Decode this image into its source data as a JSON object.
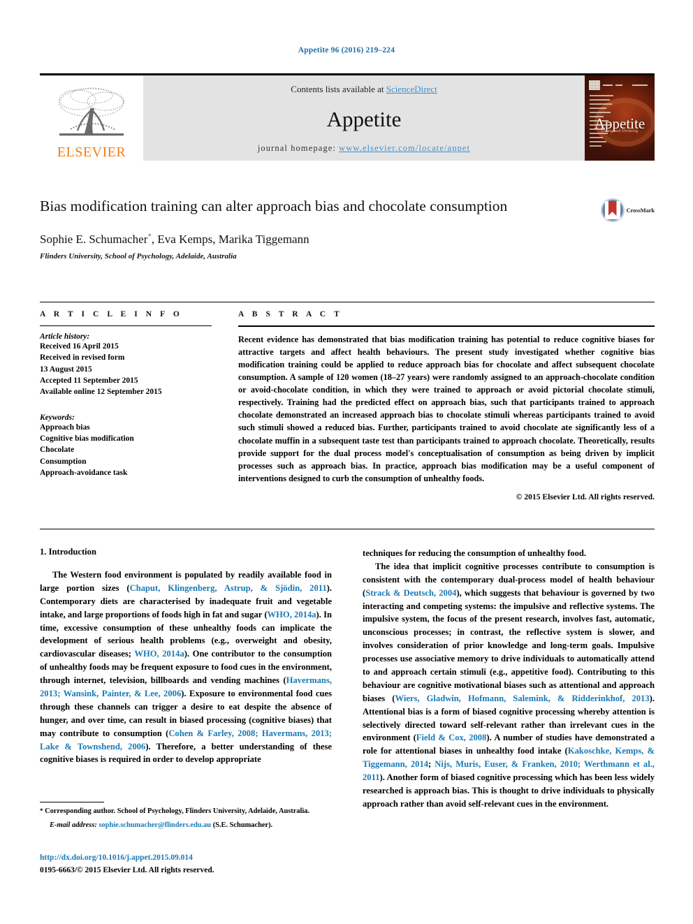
{
  "running_head": "Appetite 96 (2016) 219–224",
  "masthead": {
    "publisher_name": "ELSEVIER",
    "contents_prefix": "Contents lists available at ",
    "contents_link": "ScienceDirect",
    "journal_name": "Appetite",
    "homepage_prefix": "journal homepage: ",
    "homepage_url": "www.elsevier.com/locate/appet",
    "cover_title": "Appetite",
    "cover_subtitle": "Eating and Drinking"
  },
  "article": {
    "title": "Bias modification training can alter approach bias and chocolate consumption",
    "authors": "Sophie E. Schumacher, Eva Kemps, Marika Tiggemann",
    "corresponding_marker": "*",
    "affiliation": "Flinders University, School of Psychology, Adelaide, Australia",
    "crossmark_label": "CrossMark"
  },
  "info": {
    "heading": "A R T I C L E   I N F O",
    "history_label": "Article history:",
    "history": [
      "Received 16 April 2015",
      "Received in revised form",
      "13 August 2015",
      "Accepted 11 September 2015",
      "Available online 12 September 2015"
    ],
    "keywords_label": "Keywords:",
    "keywords": [
      "Approach bias",
      "Cognitive bias modification",
      "Chocolate",
      "Consumption",
      "Approach-avoidance task"
    ]
  },
  "abstract": {
    "heading": "A B S T R A C T",
    "text": "Recent evidence has demonstrated that bias modification training has potential to reduce cognitive biases for attractive targets and affect health behaviours. The present study investigated whether cognitive bias modification training could be applied to reduce approach bias for chocolate and affect subsequent chocolate consumption. A sample of 120 women (18–27 years) were randomly assigned to an approach-chocolate condition or avoid-chocolate condition, in which they were trained to approach or avoid pictorial chocolate stimuli, respectively. Training had the predicted effect on approach bias, such that participants trained to approach chocolate demonstrated an increased approach bias to chocolate stimuli whereas participants trained to avoid such stimuli showed a reduced bias. Further, participants trained to avoid chocolate ate significantly less of a chocolate muffin in a subsequent taste test than participants trained to approach chocolate. Theoretically, results provide support for the dual process model's conceptualisation of consumption as being driven by implicit processes such as approach bias. In practice, approach bias modification may be a useful component of interventions designed to curb the consumption of unhealthy foods.",
    "copyright": "© 2015 Elsevier Ltd. All rights reserved."
  },
  "body": {
    "section_heading": "1.  Introduction",
    "left_paragraph_1": {
      "p1": "The Western food environment is populated by readily available food in large portion sizes (",
      "c1": "Chaput, Klingenberg, Astrup, & Sjödin, 2011",
      "p2": "). Contemporary diets are characterised by inadequate fruit and vegetable intake, and large proportions of foods high in fat and sugar (",
      "c2": "WHO, 2014a",
      "p3": "). In time, excessive consumption of these unhealthy foods can implicate the development of serious health problems (e.g., overweight and obesity, cardiovascular diseases; ",
      "c3": "WHO, 2014a",
      "p4": "). One contributor to the consumption of unhealthy foods may be frequent exposure to food cues in the environment, through internet, television, billboards and vending machines (",
      "c4": "Havermans, 2013; Wansink, Painter, & Lee, 2006",
      "p5": "). Exposure to environmental food cues through these channels can trigger a desire to eat despite the absence of hunger, and over time, can result in biased processing (cognitive biases) that may contribute to consumption (",
      "c5": "Cohen & Farley, 2008; Havermans, 2013; Lake & Townshend, 2006",
      "p6": "). Therefore, a better understanding of these cognitive biases is required in order to develop appropriate"
    },
    "right_paragraph_0": "techniques for reducing the consumption of unhealthy food.",
    "right_paragraph_1": {
      "p1": "The idea that implicit cognitive processes contribute to consumption is consistent with the contemporary dual-process model of health behaviour (",
      "c1": "Strack & Deutsch, 2004",
      "p2": "), which suggests that behaviour is governed by two interacting and competing systems: the impulsive and reflective systems. The impulsive system, the focus of the present research, involves fast, automatic, unconscious processes; in contrast, the reflective system is slower, and involves consideration of prior knowledge and long-term goals. Impulsive processes use associative memory to drive individuals to automatically attend to and approach certain stimuli (e.g., appetitive food). Contributing to this behaviour are cognitive motivational biases such as attentional and approach biases (",
      "c2": "Wiers, Gladwin, Hofmann, Salemink, & Ridderinkhof, 2013",
      "p3": "). Attentional bias is a form of biased cognitive processing whereby attention is selectively directed toward self-relevant rather than irrelevant cues in the environment (",
      "c3": "Field & Cox, 2008",
      "p4": "). A number of studies have demonstrated a role for attentional biases in unhealthy food intake (",
      "c4": "Kakoschke, Kemps, & Tiggemann, 2014",
      "p5": "; ",
      "c5": "Nijs, Muris, Euser, & Franken, 2010; Werthmann et al., 2011",
      "p6": "). Another form of biased cognitive processing which has been less widely researched is approach bias. This is thought to drive individuals to physically approach rather than avoid self-relevant cues in the environment."
    }
  },
  "footnote": {
    "star": "*",
    "corresponding": " Corresponding author. School of Psychology, Flinders University, Adelaide, Australia.",
    "email_label": "E-mail address:",
    "email": "sophie.schumacher@flinders.edu.au",
    "email_suffix": " (S.E. Schumacher)."
  },
  "footer": {
    "doi": "http://dx.doi.org/10.1016/j.appet.2015.09.014",
    "issn_line": "0195-6663/© 2015 Elsevier Ltd. All rights reserved."
  },
  "colors": {
    "link_blue": "#1a7ab5",
    "elsevier_orange": "#F07F13",
    "masthead_grey": "#e3e3e3",
    "crossmark_red": "#c0362c"
  }
}
